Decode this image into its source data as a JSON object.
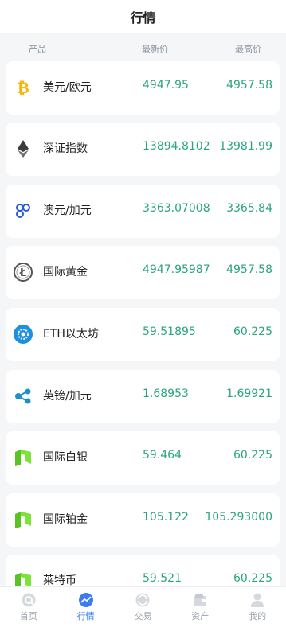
{
  "header": {
    "title": "行情"
  },
  "columns": {
    "product": "产品",
    "latest": "最新价",
    "highest": "最高价"
  },
  "rows": [
    {
      "icon": "bitcoin-icon",
      "name": "美元/欧元",
      "latest": "4947.95",
      "highest": "4957.58"
    },
    {
      "icon": "ethereum-icon",
      "name": "深证指数",
      "latest": "13894.8102",
      "highest": "13981.99"
    },
    {
      "icon": "link-icon",
      "name": "澳元/加元",
      "latest": "3363.07008",
      "highest": "3365.84"
    },
    {
      "icon": "litecoin-icon",
      "name": "国际黄金",
      "latest": "4947.95987",
      "highest": "4957.58"
    },
    {
      "icon": "gear-coin-icon",
      "name": "ETH以太坊",
      "latest": "59.51895",
      "highest": "60.225"
    },
    {
      "icon": "ripple-icon",
      "name": "英镑/加元",
      "latest": "1.68953",
      "highest": "1.69921"
    },
    {
      "icon": "neo-icon",
      "name": "国际白银",
      "latest": "59.464",
      "highest": "60.225"
    },
    {
      "icon": "neo-icon",
      "name": "国际铂金",
      "latest": "105.122",
      "highest": "105.293000"
    },
    {
      "icon": "neo-icon",
      "name": "莱特币",
      "latest": "59.521",
      "highest": "60.225"
    }
  ],
  "tabbar": {
    "items": [
      {
        "icon": "home-icon",
        "label": "首页",
        "active": false
      },
      {
        "icon": "market-icon",
        "label": "行情",
        "active": true
      },
      {
        "icon": "trade-icon",
        "label": "交易",
        "active": false
      },
      {
        "icon": "wallet-icon",
        "label": "资产",
        "active": false
      },
      {
        "icon": "user-icon",
        "label": "我的",
        "active": false
      }
    ]
  },
  "colors": {
    "accent": "#3b7cf2",
    "price": "#2aa57f",
    "bitcoin": "#f7b500",
    "neo": "#58c322"
  }
}
